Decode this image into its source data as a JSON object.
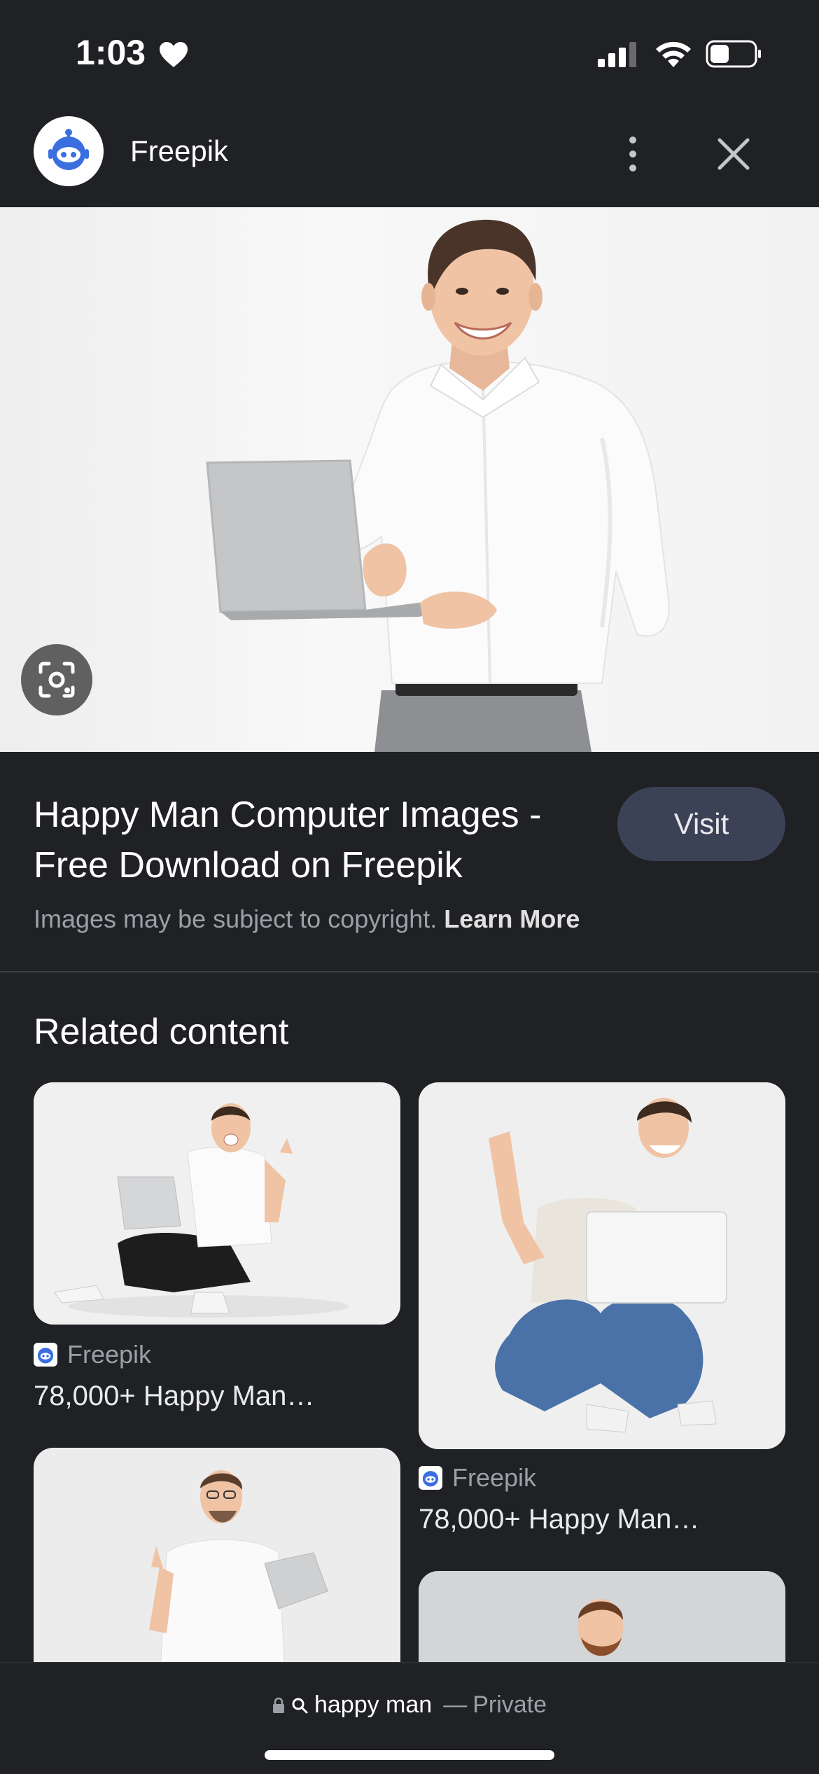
{
  "status": {
    "time": "1:03"
  },
  "header": {
    "title": "Freepik"
  },
  "result": {
    "title": "Happy Man Computer Images - Free Download on Freepik",
    "visit_label": "Visit",
    "copyright_text": "Images may be subject to copyright.",
    "learn_more": "Learn More"
  },
  "related": {
    "heading": "Related content",
    "cards": [
      {
        "source": "Freepik",
        "caption": "78,000+ Happy Man…"
      },
      {
        "source": "Freepik",
        "caption": "78,000+ Happy Man…"
      }
    ]
  },
  "address_bar": {
    "query": "happy man",
    "separator": "—",
    "mode": "Private"
  },
  "colors": {
    "background": "#202124",
    "visit_button": "#3c4255",
    "brand_blue": "#3b6fe0"
  },
  "icons": [
    "heart-icon",
    "signal-icon",
    "wifi-icon",
    "battery-icon",
    "freepik-logo-icon",
    "more-vert-icon",
    "close-icon",
    "lens-icon",
    "lock-icon",
    "search-icon"
  ]
}
